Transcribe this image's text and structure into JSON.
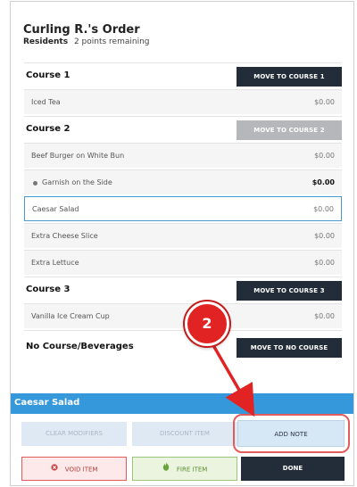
{
  "order": {
    "title": "Curling R.'s Order",
    "subtitle_label": "Residents",
    "subtitle_value": "2 points remaining"
  },
  "courses": [
    {
      "title": "Course 1",
      "move_button": "MOVE TO COURSE 1",
      "move_button_disabled": false,
      "items": [
        {
          "name": "Iced Tea",
          "price": "$0.00"
        }
      ]
    },
    {
      "title": "Course 2",
      "move_button": "MOVE TO COURSE 2",
      "move_button_disabled": true,
      "items": [
        {
          "name": "Beef Burger on White Bun",
          "price": "$0.00"
        },
        {
          "name": "Garnish on the Side",
          "price": "$0.00",
          "modifier": true
        },
        {
          "name": "Caesar Salad",
          "price": "$0.00",
          "selected": true
        },
        {
          "name": "Extra Cheese Slice",
          "price": "$0.00"
        },
        {
          "name": "Extra Lettuce",
          "price": "$0.00"
        }
      ]
    },
    {
      "title": "Course 3",
      "move_button": "MOVE TO COURSE 3",
      "move_button_disabled": false,
      "items": [
        {
          "name": "Vanilla Ice Cream Cup",
          "price": "$0.00"
        }
      ]
    },
    {
      "title": "No Course/Beverages",
      "move_button": "MOVE TO NO COURSE",
      "move_button_disabled": false,
      "items": []
    }
  ],
  "selected_item_label": "Caesar Salad",
  "actions": {
    "clear_modifiers": "CLEAR MODIFIERS",
    "discount_item": "DISCOUNT ITEM",
    "add_note": "ADD NOTE",
    "void_item": "VOID ITEM",
    "fire_item": "FIRE ITEM",
    "done": "DONE"
  },
  "annotation": {
    "step": "2"
  },
  "icons": {
    "void": "void-x-icon",
    "fire": "fire-icon"
  },
  "colors": {
    "dark_button": "#232d3a",
    "accent_blue": "#3498db",
    "highlight_red": "#e12423"
  }
}
